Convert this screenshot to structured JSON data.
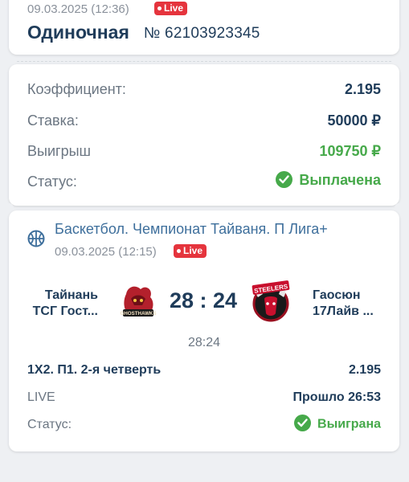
{
  "header": {
    "date": "09.03.2025 (12:36)",
    "live_badge": "Live",
    "bet_type": "Одиночная",
    "bet_number": "№ 62103923345"
  },
  "summary": {
    "coef_label": "Коэффициент:",
    "coef_value": "2.195",
    "stake_label": "Ставка:",
    "stake_value": "50000 ₽",
    "win_label": "Выигрыш",
    "win_value": "109750 ₽",
    "status_label": "Статус:",
    "status_value": "Выплачена"
  },
  "event": {
    "league": "Баскетбол. Чемпионат Тайваня. П Лига+",
    "date": "09.03.2025 (12:15)",
    "live_badge": "Live",
    "home_team_line1": "Тайнань",
    "home_team_line2": "ТСГ Гост...",
    "away_team_line1": "Гаосюн",
    "away_team_line2": "17Лайв ...",
    "score": "28 : 24",
    "score_time": "28:24",
    "market": "1Х2. П1. 2-я четверть",
    "market_coef": "2.195",
    "live_label": "LIVE",
    "elapsed": "Прошло 26:53",
    "status_label": "Статус:",
    "status_value": "Выиграна",
    "home_logo_text": "GHOSTHAWKS",
    "away_logo_text": "STEELERS"
  },
  "colors": {
    "primary_text": "#1f3c5a",
    "muted_text": "#6b7682",
    "success": "#46a94a",
    "live_red": "#e5343d",
    "link_blue": "#3e6f9c"
  },
  "icons": [
    "basketball-icon",
    "check-circle-icon",
    "live-dot-icon"
  ]
}
